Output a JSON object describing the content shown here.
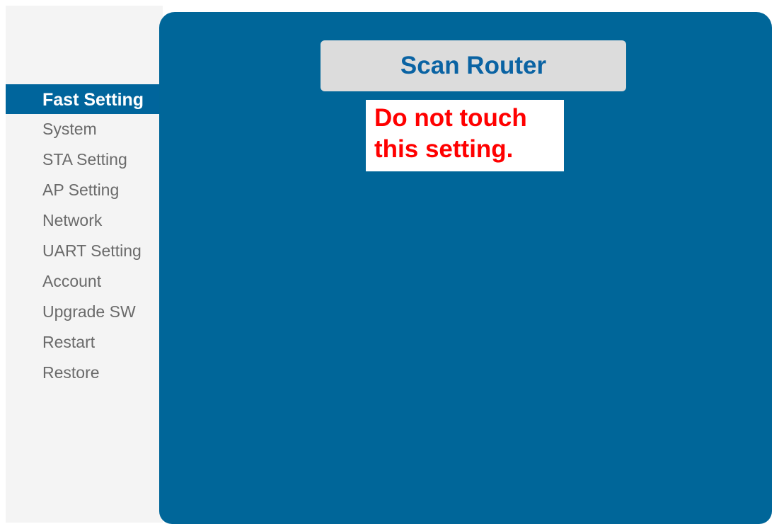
{
  "sidebar": {
    "items": [
      {
        "label": "Fast Setting",
        "active": true
      },
      {
        "label": "System",
        "active": false
      },
      {
        "label": "STA Setting",
        "active": false
      },
      {
        "label": "AP Setting",
        "active": false
      },
      {
        "label": "Network",
        "active": false
      },
      {
        "label": "UART Setting",
        "active": false
      },
      {
        "label": "Account",
        "active": false
      },
      {
        "label": "Upgrade SW",
        "active": false
      },
      {
        "label": "Restart",
        "active": false
      },
      {
        "label": "Restore",
        "active": false
      }
    ]
  },
  "main": {
    "title": "Scan Router",
    "warning": {
      "line1": "Do not touch",
      "line2": "this setting."
    }
  },
  "colors": {
    "panel_blue": "#006699",
    "active_menu_blue": "#00659C",
    "title_text_blue": "#0A63A3",
    "warning_red": "#FF0000",
    "sidebar_background": "#F4F4F4",
    "title_box_gray": "#DCDCDC"
  }
}
